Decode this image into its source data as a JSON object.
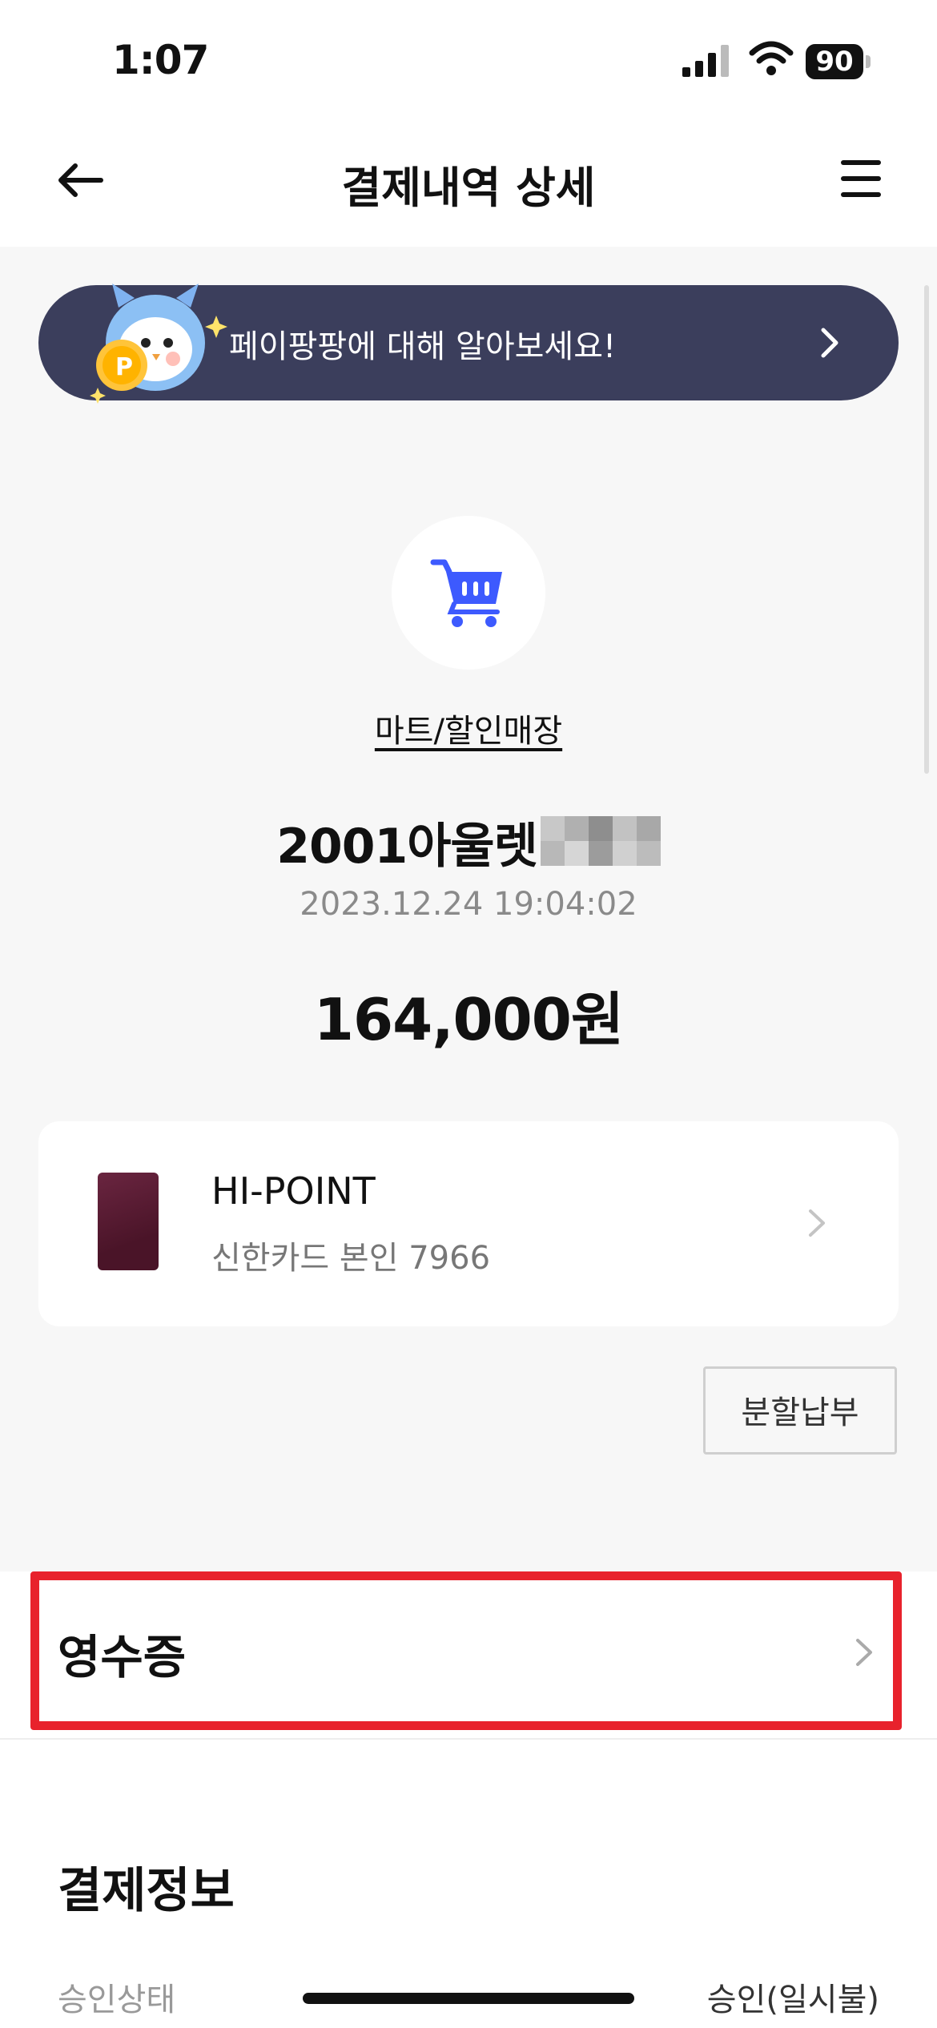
{
  "status_bar": {
    "time": "1:07",
    "battery": "90"
  },
  "header": {
    "title": "결제내역 상세",
    "back_icon": "arrow-left-icon",
    "menu_icon": "hamburger-menu-icon"
  },
  "banner": {
    "text": "페이팡팡에 대해 알아보세요!",
    "mascot_icon": "owl-mascot-icon"
  },
  "category": {
    "label": "마트/할인매장",
    "icon": "shopping-cart-icon",
    "accent_color": "#3d5afe"
  },
  "merchant": {
    "name": "2001아울렛",
    "datetime": "2023.12.24 19:04:02"
  },
  "amount": "164,000원",
  "card": {
    "name": "HI-POINT",
    "subtitle": "신한카드 본인 7966"
  },
  "installment_button": "분할납부",
  "receipt": {
    "label": "영수증",
    "highlight_color": "#e8222c"
  },
  "payment_info": {
    "title": "결제정보",
    "row_label": "승인상태",
    "row_value": "승인(일시불)"
  }
}
